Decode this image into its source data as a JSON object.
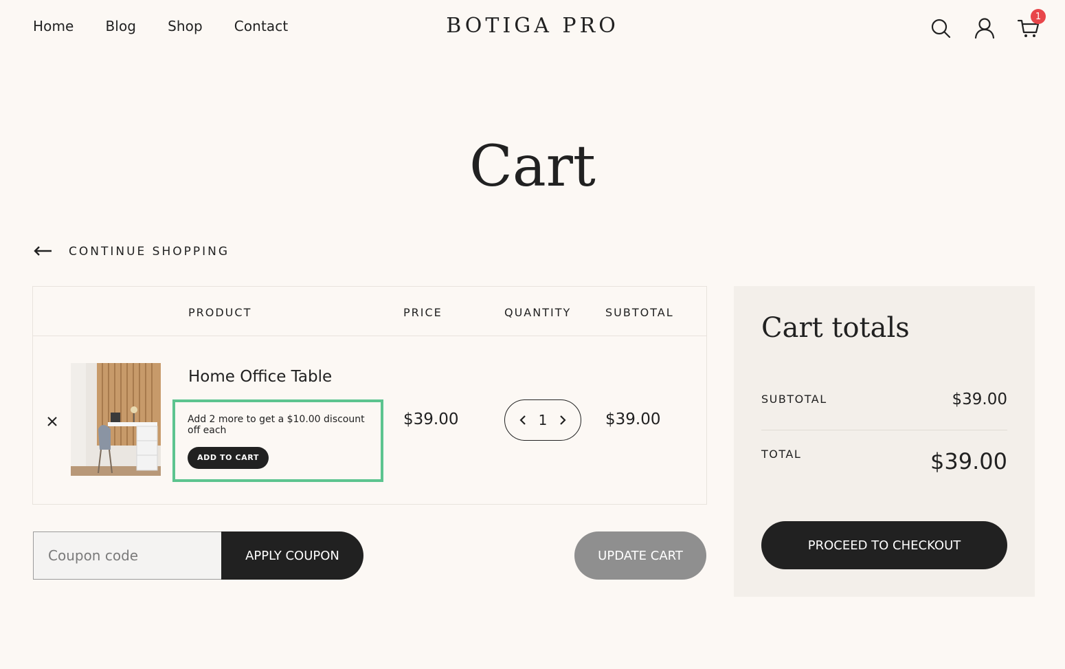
{
  "nav": {
    "items": [
      "Home",
      "Blog",
      "Shop",
      "Contact"
    ]
  },
  "logo": "BOTIGA PRO",
  "header": {
    "cart_count": "1"
  },
  "page_title": "Cart",
  "continue_shopping": "CONTINUE SHOPPING",
  "table": {
    "headers": {
      "product": "PRODUCT",
      "price": "PRICE",
      "quantity": "QUANTITY",
      "subtotal": "SUBTOTAL"
    },
    "items": [
      {
        "name": "Home Office Table",
        "promo_text": "Add 2 more to get a $10.00 discount off each",
        "promo_button": "ADD TO CART",
        "price": "$39.00",
        "quantity": "1",
        "subtotal": "$39.00"
      }
    ]
  },
  "coupon": {
    "placeholder": "Coupon code",
    "apply_label": "APPLY COUPON"
  },
  "update_cart_label": "UPDATE CART",
  "totals": {
    "title": "Cart totals",
    "subtotal_label": "SUBTOTAL",
    "subtotal_value": "$39.00",
    "total_label": "TOTAL",
    "total_value": "$39.00",
    "checkout_label": "PROCEED TO CHECKOUT"
  },
  "colors": {
    "background": "#fcf8f4",
    "accent_border": "#5cc48f",
    "badge": "#e8464a",
    "dark": "#212121",
    "totals_bg": "#f3efea"
  }
}
